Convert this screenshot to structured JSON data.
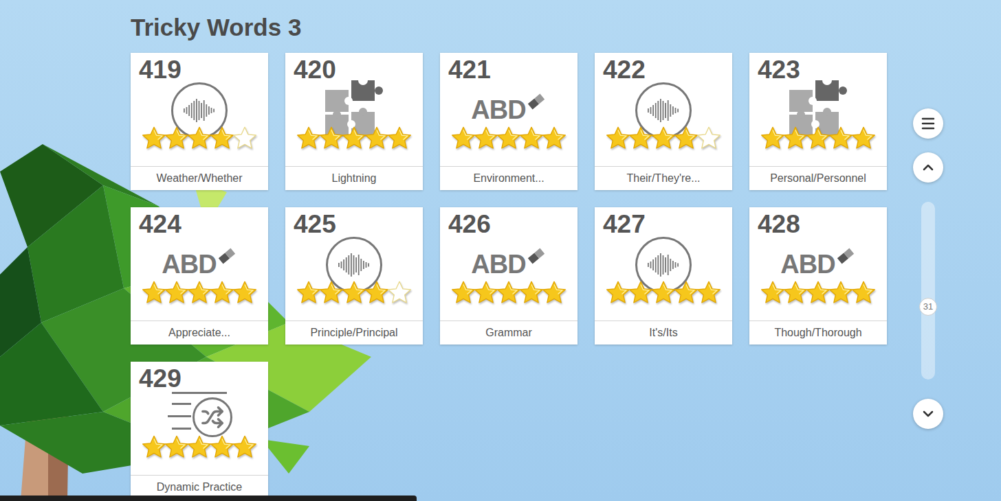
{
  "title": "Tricky Words 3",
  "spelling_icon_text": "ABD",
  "cards": [
    {
      "number": "419",
      "kind": "listen",
      "stars": 4,
      "label": "Weather/Whether"
    },
    {
      "number": "420",
      "kind": "puzzle",
      "stars": 5,
      "label": "Lightning"
    },
    {
      "number": "421",
      "kind": "spelling",
      "stars": 5,
      "label": "Environment..."
    },
    {
      "number": "422",
      "kind": "listen",
      "stars": 4,
      "label": "Their/They're..."
    },
    {
      "number": "423",
      "kind": "puzzle",
      "stars": 5,
      "label": "Personal/Personnel"
    },
    {
      "number": "424",
      "kind": "spelling",
      "stars": 5,
      "label": "Appreciate..."
    },
    {
      "number": "425",
      "kind": "listen",
      "stars": 4,
      "label": "Principle/Principal"
    },
    {
      "number": "426",
      "kind": "spelling",
      "stars": 5,
      "label": "Grammar"
    },
    {
      "number": "427",
      "kind": "listen",
      "stars": 5,
      "label": "It's/Its"
    },
    {
      "number": "428",
      "kind": "spelling",
      "stars": 5,
      "label": "Though/Thorough"
    },
    {
      "number": "429",
      "kind": "dynamic",
      "stars": 5,
      "label": "Dynamic Practice"
    }
  ],
  "scroll": {
    "badge": "31",
    "level": 0.59
  }
}
